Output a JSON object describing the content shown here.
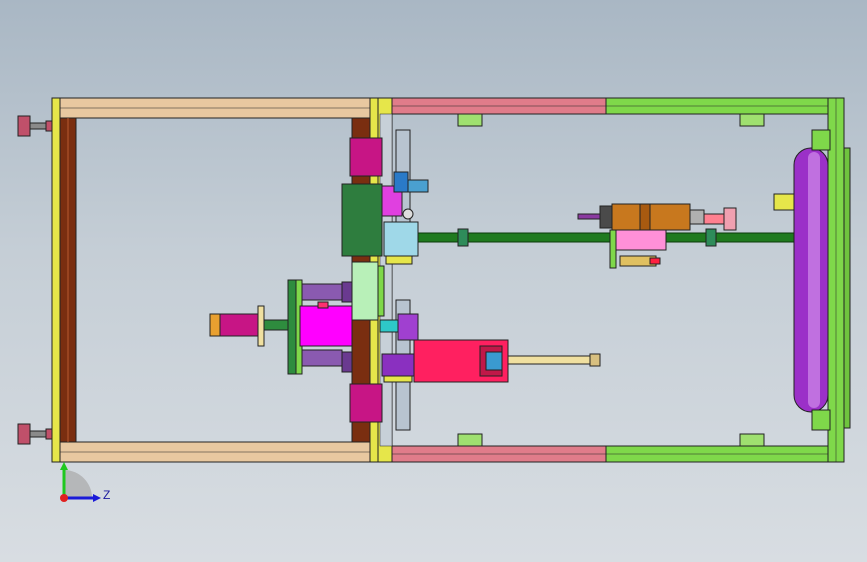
{
  "viewport": {
    "background_top": "#a9b7c4",
    "background_bottom": "#d8dde2"
  },
  "triad": {
    "axis_label": "Z",
    "icon": "coordinate-triad-icon"
  },
  "palette": {
    "frame_tan": "#e8c8a0",
    "frame_yellow": "#e6e64a",
    "rail_pink": "#e07c8a",
    "rail_green": "#7fd84a",
    "column_brown": "#6a2a12",
    "magenta": "#ff00ff",
    "purple": "#9b30c8",
    "dark_green": "#1f7a1f",
    "red_block": "#ff2060",
    "orange": "#c8781e"
  }
}
